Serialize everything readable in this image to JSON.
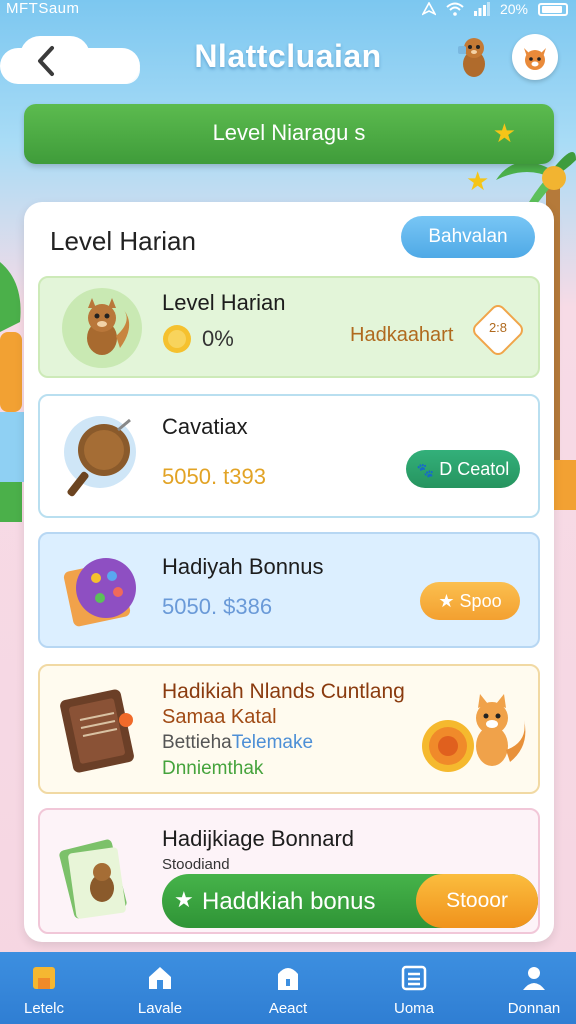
{
  "status_bar": {
    "carrier": "MFTSaum",
    "battery_text": "20%"
  },
  "header": {
    "title": "Nlattcluaian",
    "back_icon": "chevron-left-icon",
    "mascot_icon": "squirrel-mascot-icon",
    "avatar_icon": "fox-avatar-icon"
  },
  "banner": {
    "label": "Level Niaragu s",
    "accent_color": "#4aab42"
  },
  "panel": {
    "title": "Level Harian",
    "action_label": "Bahvalan"
  },
  "items": [
    {
      "title": "Level Harian",
      "value": "0%",
      "action_label": "Hadkaahart",
      "badge_text": "2:8",
      "bg": "#e2f5d8",
      "border": "#cdeab8"
    },
    {
      "title": "Cavatiax",
      "value": "5050. t393",
      "action_label": "D Ceatol",
      "bg": "#ffffff",
      "border": "#b9dff0"
    },
    {
      "title": "Hadiyah Bonnus",
      "value": "5050. $386",
      "action_label": "Spoo",
      "bg": "#dbeffc",
      "border": "#b7d7f3"
    },
    {
      "title": "Hadikiah Nlands Cuntlang",
      "subtitle": "Samaa Katal",
      "line3a": "Bettieha",
      "line3b": "Telemake",
      "line4": "Dnniemthak",
      "bg": "#fffbef",
      "border": "#f1d9a3"
    },
    {
      "title": "Hadijkiage Bonnard",
      "subtitle": "Stoodiand",
      "bar_label": "Haddkiah bonus",
      "bar_button": "Stooor",
      "bg": "#fdf4f8",
      "border": "#f1c7d8"
    }
  ],
  "bottom_nav": [
    {
      "label": "Letelc",
      "icon": "home-icon"
    },
    {
      "label": "Lavale",
      "icon": "house-icon"
    },
    {
      "label": "Aeact",
      "icon": "shield-icon"
    },
    {
      "label": "Uoma",
      "icon": "list-icon"
    },
    {
      "label": "Donnan",
      "icon": "profile-icon"
    }
  ]
}
